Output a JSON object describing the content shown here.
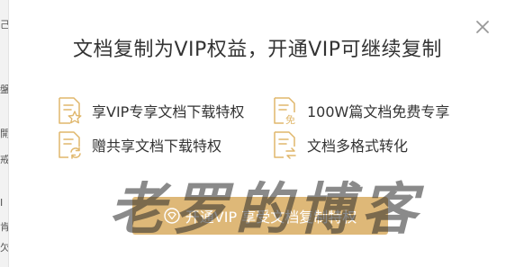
{
  "dialog": {
    "title": "文档复制为VIP权益，开通VIP可继续复制",
    "close_icon": "close-icon",
    "benefits": [
      {
        "label": "享VIP专享文档下载特权",
        "icon": "document-star-icon"
      },
      {
        "label": "100W篇文档免费专享",
        "icon": "document-free-icon"
      },
      {
        "label": "赠共享文档下载特权",
        "icon": "document-refresh-icon"
      },
      {
        "label": "文档多格式转化",
        "icon": "document-convert-icon"
      }
    ],
    "cta": {
      "label": "开通VIP 享受文档复制特权",
      "icon": "diamond-icon"
    },
    "watermark": {
      "text": "老罗的博客"
    }
  },
  "colors": {
    "accent": "#deb878",
    "icon_stroke": "#e0b76c",
    "title_text": "#333333",
    "close_icon": "#999999"
  }
}
